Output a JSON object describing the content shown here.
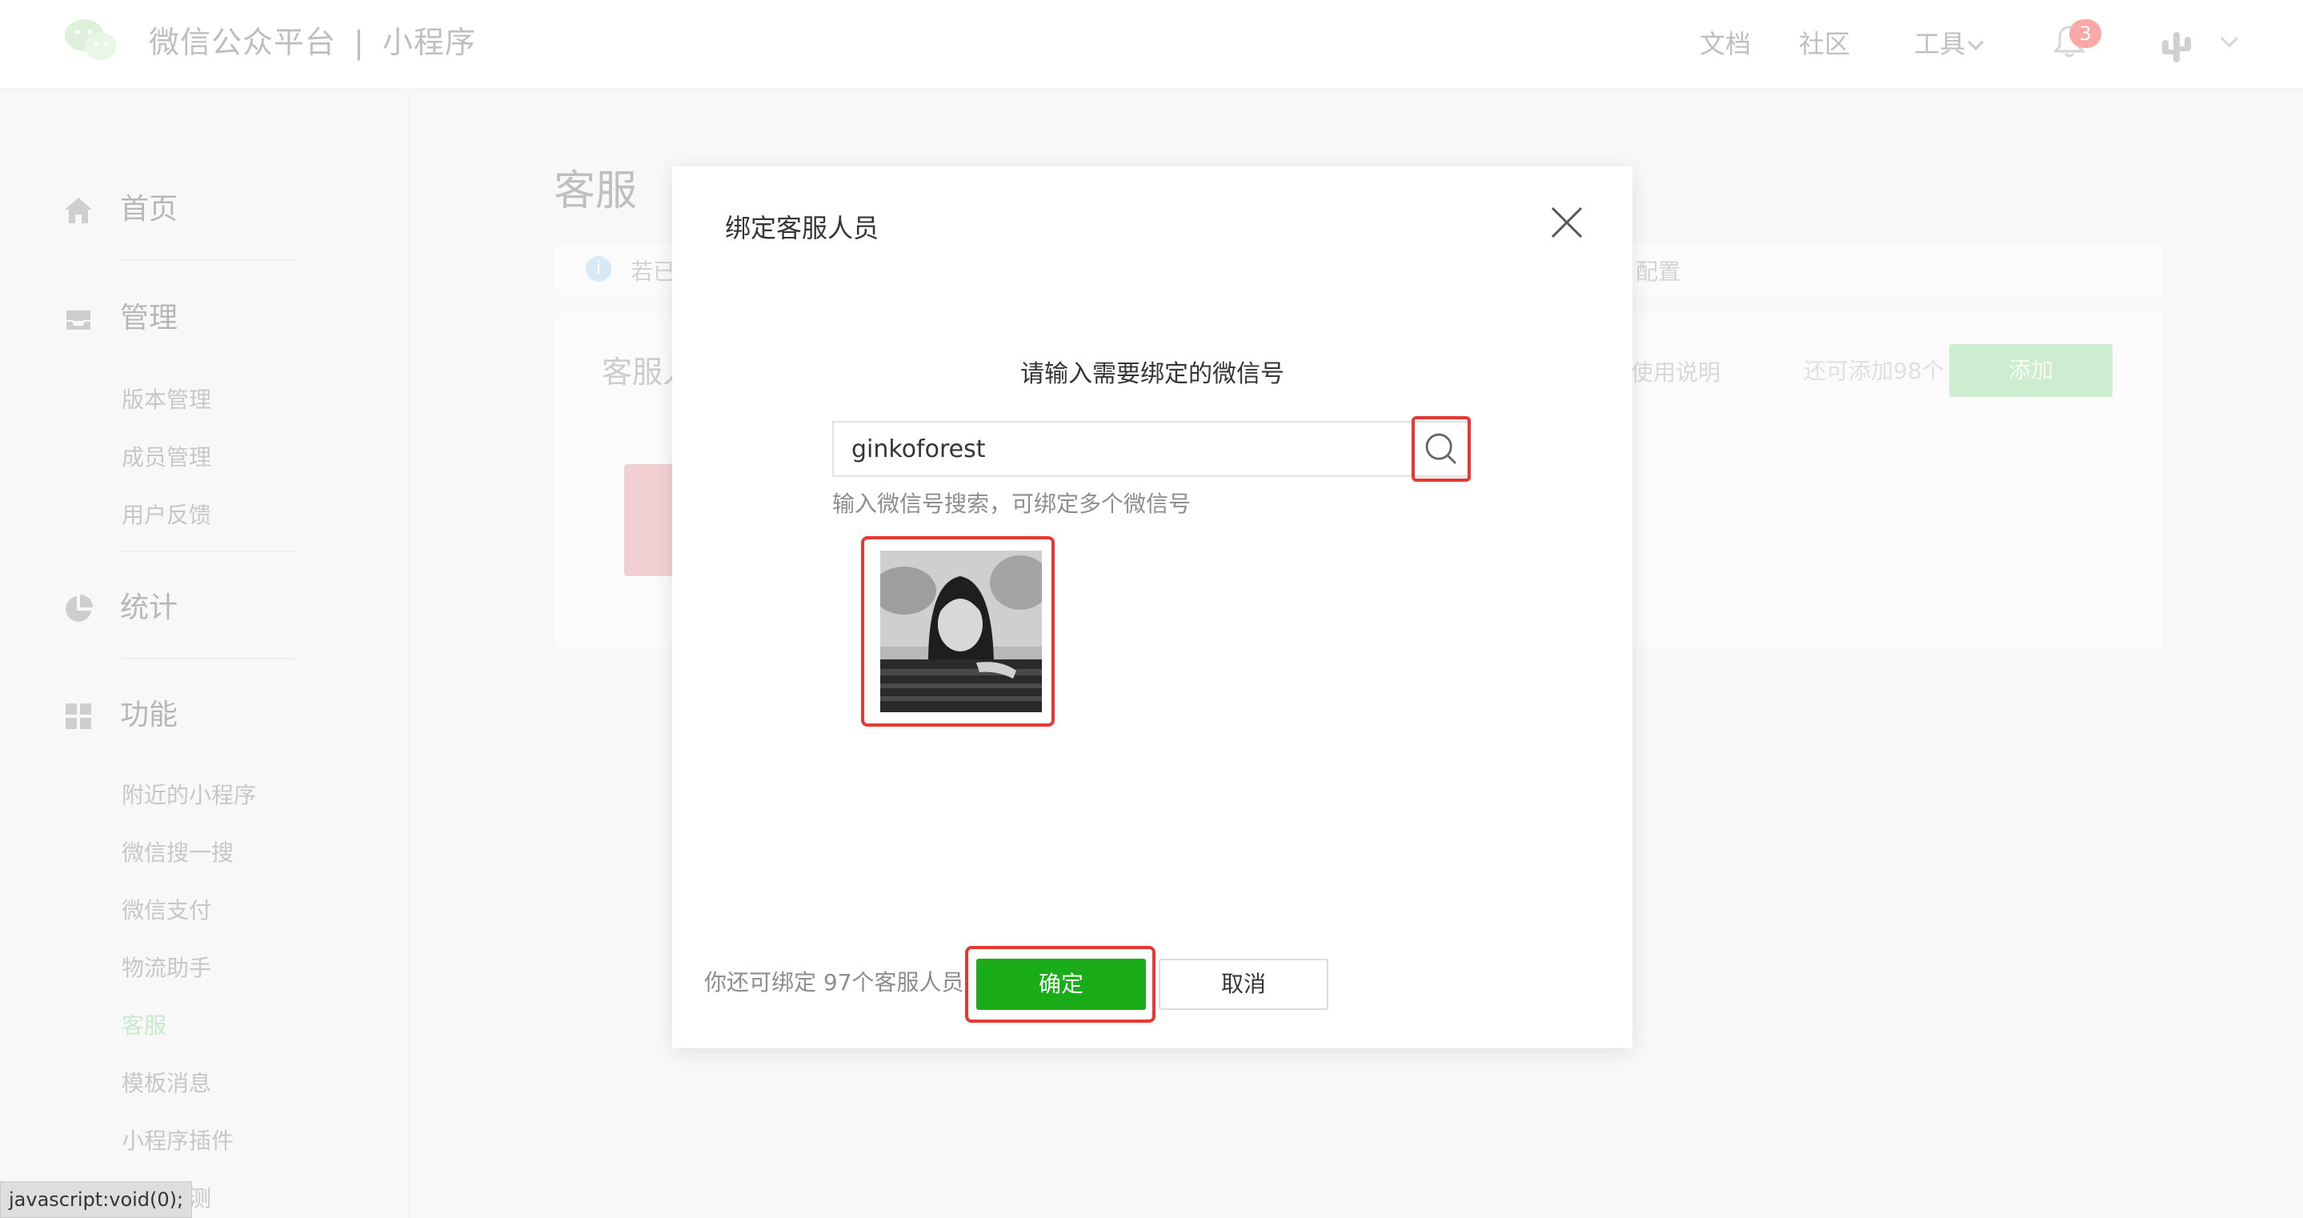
{
  "topbar": {
    "brand_name": "微信公众平台",
    "separator": "|",
    "brand_sub": "小程序",
    "nav": {
      "docs": "文档",
      "community": "社区",
      "tools": "工具"
    },
    "notification_count": "3"
  },
  "sidebar": {
    "home": "首页",
    "manage": "管理",
    "manage_items": [
      "版本管理",
      "成员管理",
      "用户反馈"
    ],
    "stats": "统计",
    "features": "功能",
    "feature_items": [
      "附近的小程序",
      "微信搜一搜",
      "微信支付",
      "物流助手",
      "客服",
      "模板消息",
      "小程序插件",
      "服务评测"
    ],
    "active_item": "客服"
  },
  "main": {
    "title": "客服",
    "notice_start": "若已",
    "notice_end": "配置",
    "panel_title": "客服人",
    "usage_link": "使用说明",
    "remaining": "还可添加98个",
    "add_button": "添加"
  },
  "modal": {
    "title": "绑定客服人员",
    "prompt": "请输入需要绑定的微信号",
    "search_value": "ginkoforest",
    "hint": "输入微信号搜索，可绑定多个微信号",
    "footer_count": "你还可绑定 97个客服人员",
    "confirm": "确定",
    "cancel": "取消"
  },
  "statusbar": {
    "text": "javascript:void(0);"
  },
  "colors": {
    "primary_green": "#1aad19",
    "highlight_red": "#e53935",
    "active_sidebar": "#9fd6a4",
    "badge_red": "#f76260"
  }
}
